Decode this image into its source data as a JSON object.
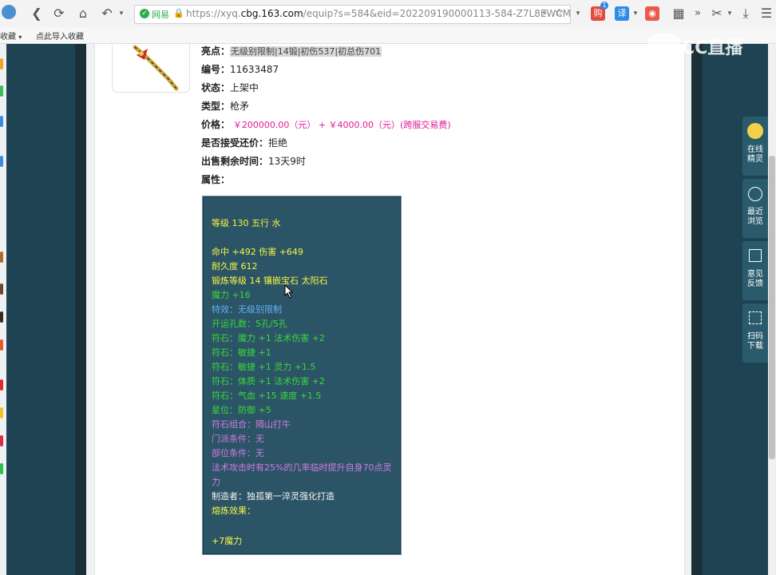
{
  "browser": {
    "address": {
      "site_label": "网易",
      "url_prefix": "https://xyq.",
      "url_domain": "cbg.163.com",
      "url_rest": "/equip?s=584&eid=202209190000113-584-Z7L8EWCM"
    },
    "extensions": {
      "badge_count": "1",
      "translate": "译"
    }
  },
  "bookmarks": {
    "favorites": "收藏",
    "import": "点此导入收藏"
  },
  "watermark": "CC直播",
  "item": {
    "highlights_label": "亮点：",
    "highlights_value": "无级别限制|14锻|初伤537|初总伤701",
    "id_label": "编号：",
    "id_value": "11633487",
    "status_label": "状态：",
    "status_value": "上架中",
    "type_label": "类型：",
    "type_value": "枪矛",
    "price_label": "价格：",
    "price_value": "￥200000.00（元） +  ￥4000.00（元）(跨服交易费)",
    "bargain_label": "是否接受还价：",
    "bargain_value": "拒绝",
    "time_label": "出售剩余时间：",
    "time_value": "13天9时",
    "attr_label": "属性："
  },
  "attributes": {
    "level": "等级 130 五行 水",
    "hit": "命中 +492 伤害 +649",
    "durability": "耐久度 612",
    "forge": "锻炼等级 14 镶嵌宝石 太阳石",
    "magic": "魔力 +16",
    "special": "特效：无级别限制",
    "holes": "开运孔数：5孔/5孔",
    "rune1": "符石：魔力 +1 法术伤害 +2",
    "rune2": "符石：敏捷 +1",
    "rune3": "符石：敏捷 +1 灵力 +1.5",
    "rune4": "符石：体质 +1 法术伤害 +2",
    "rune5": "符石：气血 +15 速度 +1.5",
    "star": "星位：防御 +5",
    "combo": "符石组合：隔山打牛",
    "school": "门派条件：无",
    "part": "部位条件：无",
    "effect_line1": "法术攻击时有25%的几率临时提升自身70点灵",
    "effect_line2": "力",
    "maker": "制造者：独孤第一淬灵强化打造",
    "smelt": "熔炼效果：",
    "smelt_value": "+7魔力"
  },
  "sidebar": {
    "online": [
      "在线",
      "精灵"
    ],
    "recent": [
      "最近",
      "浏览"
    ],
    "feedback": [
      "意见",
      "反馈"
    ],
    "scan": [
      "扫码",
      "下载"
    ]
  },
  "colors": {
    "page_bg": "#1f4050",
    "panel_bg": "#2c5467",
    "yellow": "#f5f542",
    "green": "#39d839",
    "blue": "#5fb3f2",
    "purple": "#d07be0",
    "price": "#e01a9a",
    "float": "#2a5b6c"
  }
}
